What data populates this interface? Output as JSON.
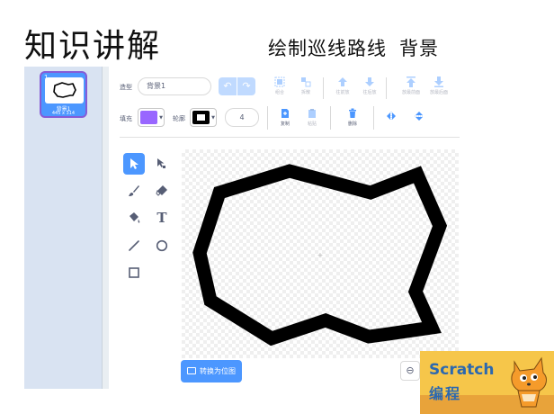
{
  "slide": {
    "title": "知识讲解",
    "subtitle_left": "绘制巡线路线",
    "subtitle_right": "背景"
  },
  "sidebar": {
    "costume": {
      "number": "1",
      "name": "背景1",
      "size": "445 x 314"
    }
  },
  "toolbar": {
    "costume_label": "造型",
    "costume_name_value": "背景1",
    "undo_icon": "undo-icon",
    "redo_icon": "redo-icon",
    "group_label": "组合",
    "ungroup_label": "拆散",
    "forward_label": "往前放",
    "backward_label": "往后放",
    "front_label": "放最前面",
    "back_label": "放最后面",
    "fill_label": "填充",
    "fill_color": "#9966ff",
    "outline_label": "轮廓",
    "outline_color": "#000000",
    "outline_width": "4",
    "copy_label": "复制",
    "paste_label": "粘贴",
    "delete_label": "删除",
    "flip_h_icon": "flip-horizontal-icon",
    "flip_v_icon": "flip-vertical-icon"
  },
  "tools": {
    "select": "select-arrow-icon",
    "reshape": "reshape-icon",
    "brush": "brush-icon",
    "eraser": "eraser-icon",
    "fill": "fill-bucket-icon",
    "text": "T",
    "line": "line-icon",
    "circle": "circle-icon",
    "rect": "rectangle-icon"
  },
  "canvas": {
    "shape_stroke": "#000000",
    "center_mark": "+"
  },
  "bottom": {
    "convert_label": "转换为位图",
    "zoom_icon": "zoom-out-icon"
  },
  "logo": {
    "word1": "Scratch",
    "word2": "编程"
  },
  "colors": {
    "accent": "#4c97ff",
    "selected_border": "#855cd6",
    "sidebar_bg": "#d9e3f2",
    "delete_red": "#e05d5d"
  }
}
